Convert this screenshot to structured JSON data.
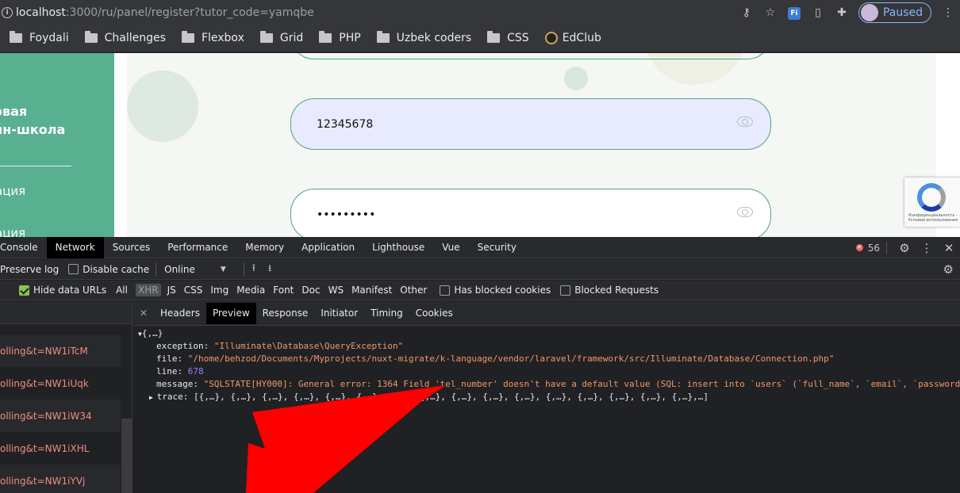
{
  "address_bar": {
    "host": "localhost",
    "path": ":3000/ru/panel/register?tutor_code=yamqbe",
    "profile_status": "Paused",
    "ext_label": "Fi"
  },
  "bookmarks": [
    {
      "label": "Foydali",
      "icon": "folder-icon"
    },
    {
      "label": "Challenges",
      "icon": "folder-icon"
    },
    {
      "label": "Flexbox",
      "icon": "folder-icon"
    },
    {
      "label": "Grid",
      "icon": "folder-icon"
    },
    {
      "label": "PHP",
      "icon": "folder-icon"
    },
    {
      "label": "Uzbek coders",
      "icon": "folder-icon"
    },
    {
      "label": "CSS",
      "icon": "folder-icon"
    },
    {
      "label": "EdClub",
      "icon": "edclub-icon"
    }
  ],
  "page": {
    "brand_line1": "овая",
    "brand_line2": "йн-школа",
    "nav_item1": "ация",
    "nav_item2": "ация",
    "phone_value": "12345678",
    "password_masked": "•••••••••",
    "recaptcha_text": "Конфиденциальность - Условия использования"
  },
  "devtools": {
    "tabs": [
      "Console",
      "Network",
      "Sources",
      "Performance",
      "Memory",
      "Application",
      "Lighthouse",
      "Vue",
      "Security"
    ],
    "active_tab": "Network",
    "error_count": "56",
    "toolbar": {
      "preserve_log": "Preserve log",
      "disable_cache": "Disable cache",
      "throttle": "Online"
    },
    "filters": {
      "hide_data_urls": "Hide data URLs",
      "all": "All",
      "xhr": "XHR",
      "types": [
        "JS",
        "CSS",
        "Img",
        "Media",
        "Font",
        "Doc",
        "WS",
        "Manifest",
        "Other"
      ],
      "blocked_cookies": "Has blocked cookies",
      "blocked_requests": "Blocked Requests"
    },
    "requests": [
      "olling&t=NW1iTcM",
      "olling&t=NW1iUqk",
      "olling&t=NW1iW34",
      "olling&t=NW1iXHL",
      "olling&t=NW1iYVj"
    ],
    "detail_tabs": [
      "Headers",
      "Preview",
      "Response",
      "Initiator",
      "Timing",
      "Cookies"
    ],
    "active_detail_tab": "Preview",
    "preview": {
      "root": "{,…}",
      "exception_key": "exception",
      "exception": "\"Illuminate\\Database\\QueryException\"",
      "file_key": "file",
      "file": "\"/home/behzod/Documents/Myprojects/nuxt-migrate/k-language/vendor/laravel/framework/src/Illuminate/Database/Connection.php\"",
      "line_key": "line",
      "line": "678",
      "message_key": "message",
      "message": "\"SQLSTATE[HY000]: General error: 1364 Field 'tel_number' doesn't have a default value (SQL: insert into `users` (`full_name`, `email`, `password",
      "trace_key": "trace",
      "trace": "[{,…}, {,…}, {,…}, {,…}, {,…}, {,…}, {,…}, {,…}, {,…}, {,…}, {,…}, {,…}, {,…}, {,…}, {,…}, {,…},…]"
    }
  },
  "colors": {
    "annotation_arrow": "#ff0000",
    "sidebar_green": "#58b090",
    "field_focus_bg": "#e8eafe"
  }
}
